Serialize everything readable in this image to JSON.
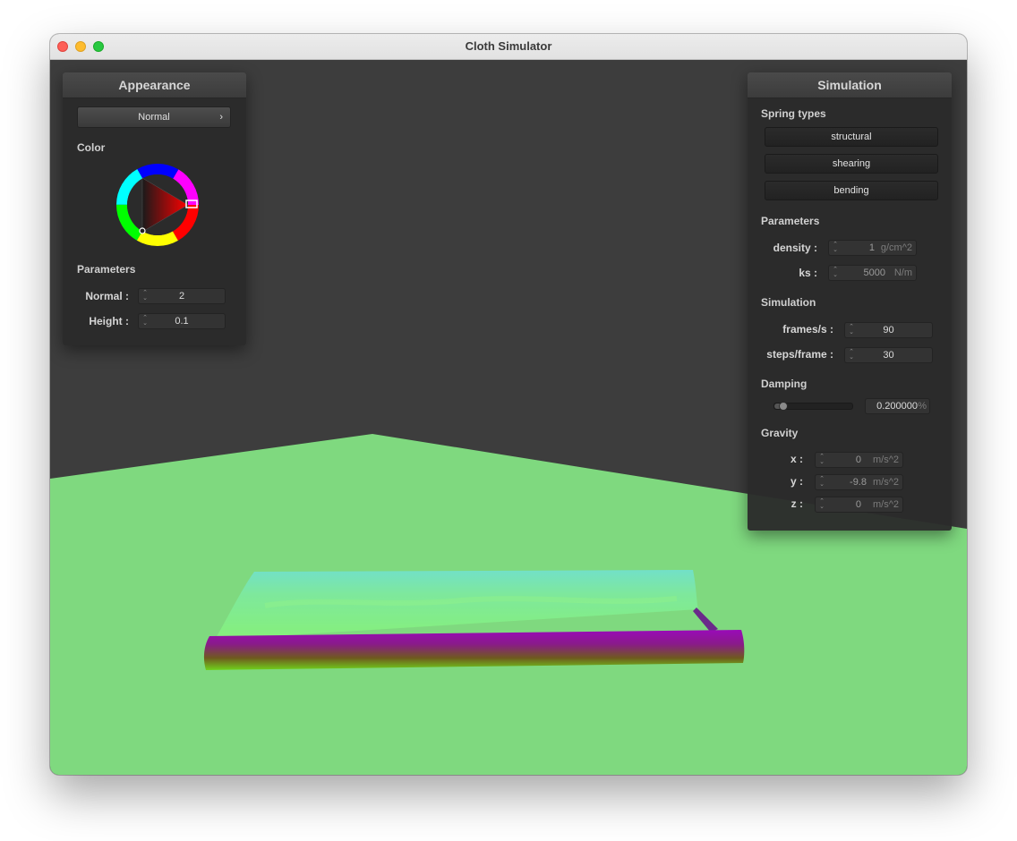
{
  "window": {
    "title": "Cloth Simulator"
  },
  "appearance": {
    "title": "Appearance",
    "shader_select": "Normal",
    "color_label": "Color",
    "parameters_label": "Parameters",
    "params": [
      {
        "label": "Normal :",
        "value": "2"
      },
      {
        "label": "Height :",
        "value": "0.1"
      }
    ]
  },
  "simulation": {
    "title": "Simulation",
    "spring_types_label": "Spring types",
    "springs": [
      "structural",
      "shearing",
      "bending"
    ],
    "parameters_label": "Parameters",
    "density": {
      "label": "density :",
      "value": "1",
      "unit": "g/cm^2"
    },
    "ks": {
      "label": "ks :",
      "value": "5000",
      "unit": "N/m"
    },
    "simulation_label": "Simulation",
    "frames": {
      "label": "frames/s :",
      "value": "90"
    },
    "steps": {
      "label": "steps/frame :",
      "value": "30"
    },
    "damping_label": "Damping",
    "damping": {
      "value": "0.200000",
      "unit": "%",
      "slider_fraction": 0.12
    },
    "gravity_label": "Gravity",
    "gravity": [
      {
        "label": "x :",
        "value": "0",
        "unit": "m/s^2"
      },
      {
        "label": "y :",
        "value": "-9.8",
        "unit": "m/s^2"
      },
      {
        "label": "z :",
        "value": "0",
        "unit": "m/s^2"
      }
    ]
  },
  "colors": {
    "plane": "#7fd97f",
    "background": "#3d3d3d",
    "picker_selected": "#ff2a2a"
  }
}
